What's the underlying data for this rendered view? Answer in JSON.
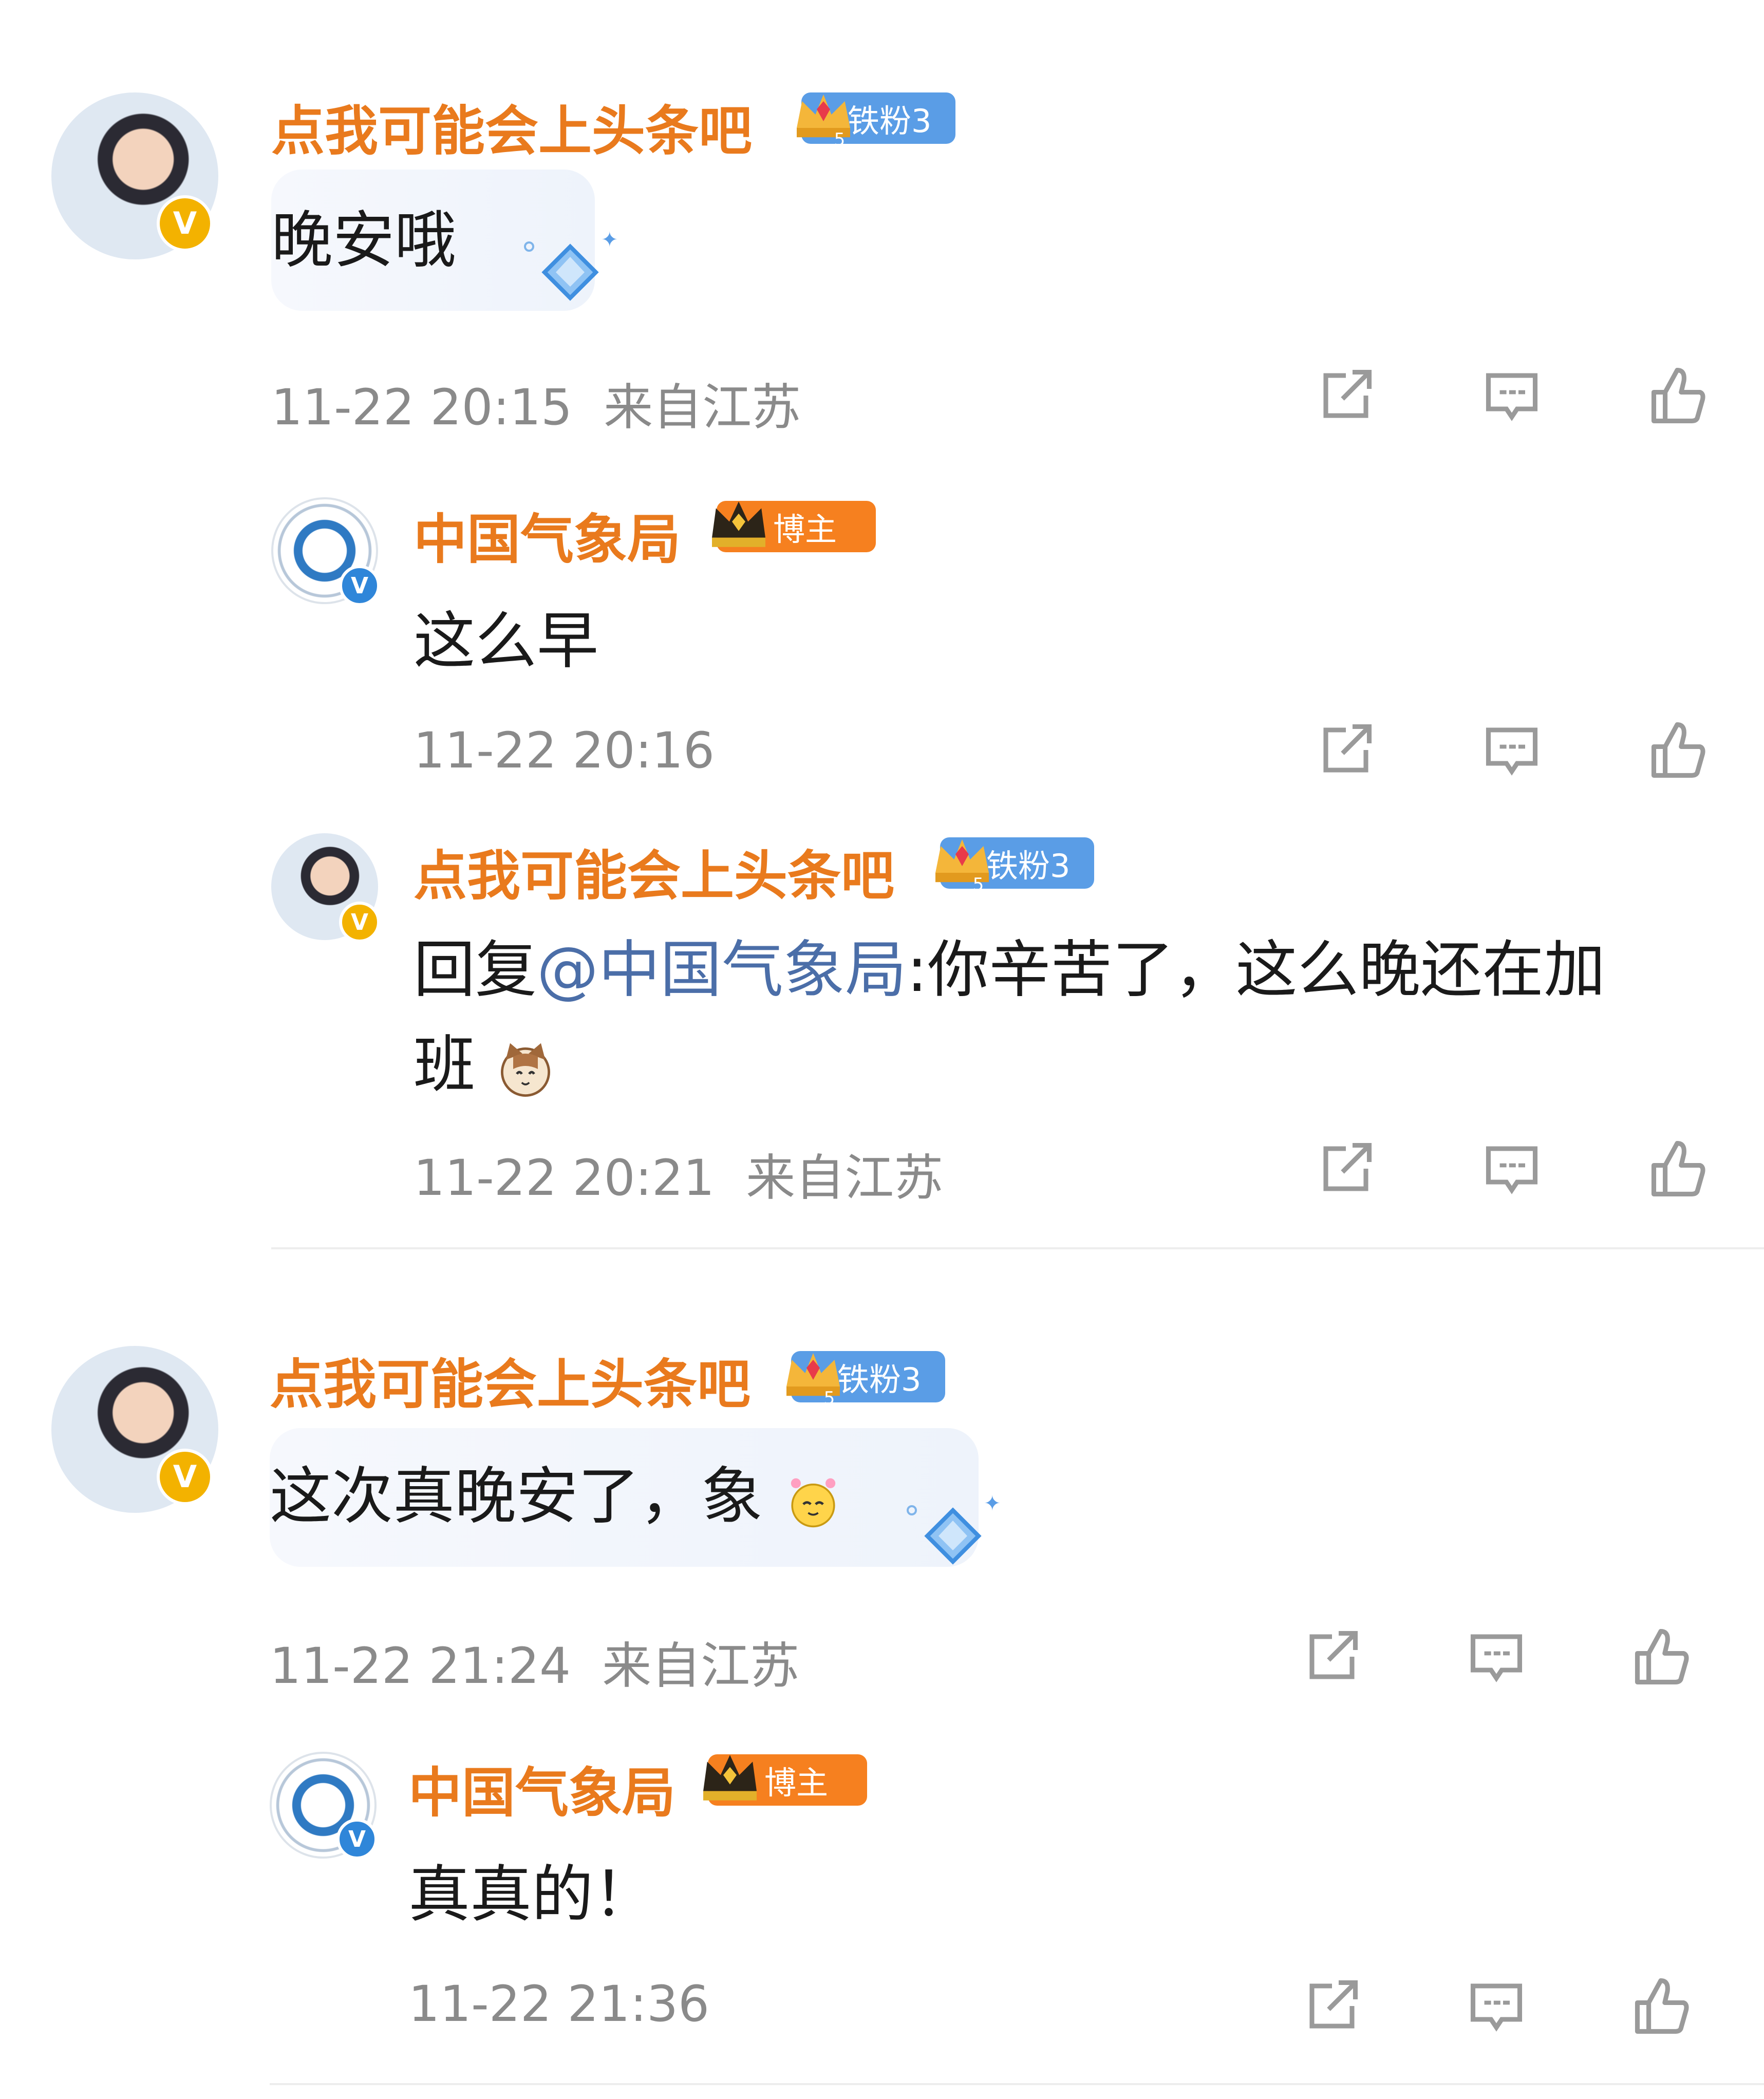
{
  "colors": {
    "name_orange": "#e97a1d",
    "mention_blue": "#4b6ea8",
    "meta_gray": "#8a8a8a",
    "fans_badge_blue": "#5a9de6",
    "host_badge_orange": "#f6801f",
    "verified_gold": "#f3b200",
    "verified_blue": "#2f86d9"
  },
  "comments": [
    {
      "user": "点我可能会上头条吧",
      "badge": "铁粉3",
      "text": "晚安哦",
      "time": "11-22 20:15",
      "location": "来自江苏"
    },
    {
      "user": "中国气象局",
      "badge": "博主",
      "text": "这么早",
      "time": "11-22 20:16"
    },
    {
      "user": "点我可能会上头条吧",
      "badge": "铁粉3",
      "reply_prefix": "回复",
      "mention": "@中国气象局",
      "text_after_mention": ":你辛苦了，这么晚还在加",
      "text_line2": "班",
      "time": "11-22 20:21",
      "location": "来自江苏"
    },
    {
      "user": "点我可能会上头条吧",
      "badge": "铁粉3",
      "text": "这次真晚安了，象",
      "time": "11-22 21:24",
      "location": "来自江苏"
    },
    {
      "user": "中国气象局",
      "badge": "博主",
      "text": "真真的！",
      "time": "11-22 21:36"
    }
  ],
  "verified_mark": "V",
  "icons": [
    "share-icon",
    "comment-icon",
    "like-icon",
    "crown-icon",
    "diamond-icon",
    "cat-emoji-icon",
    "face-emoji-icon"
  ]
}
